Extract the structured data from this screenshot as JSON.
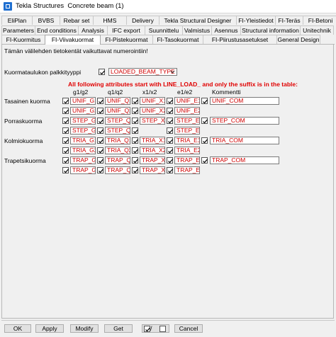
{
  "window": {
    "title": "Tekla Structures  Concrete beam (1)"
  },
  "tabs_row1": [
    "EliPlan",
    "BVBS",
    "Rebar set",
    "HMS",
    "Delivery",
    "Tekla Structural Designer",
    "FI-Yleistiedot",
    "FI-Teräs",
    "FI-Betoni"
  ],
  "tabs_row2": [
    "Parameters",
    "End conditions",
    "Analysis",
    "IFC export",
    "Suunnittelu",
    "Valmistus",
    "Asennus",
    "Structural information",
    "Unitechnik"
  ],
  "tabs_row3": [
    "FI-Kuormitus",
    "FI-Viivakuormat",
    "FI-Pistekuormat",
    "FI-Tasokuormat",
    "FI-Piirustusasetukset",
    "General Design"
  ],
  "active_tab": "FI-Viivakuormat",
  "note": "Tämän välilehden tietokentät vaikuttavat numerointiin!",
  "table_type": {
    "label": "Kuormataulukon palkkityyppi",
    "value": "LOADED_BEAM_TYPE"
  },
  "instruction": "All following attributes start with LINE_LOAD_ and only the suffix is in the table:",
  "columns": [
    "g1/g2",
    "q1/q2",
    "x1/x2",
    "e1/e2",
    "Kommentti"
  ],
  "groups": [
    {
      "label": "Tasainen kuorma",
      "row1": [
        "UNIF_G1",
        "UNIF_Q1",
        "UNIF_X1",
        "UNIF_E1"
      ],
      "row2": [
        "UNIF_G2",
        "UNIF_Q2",
        "UNIF_X2",
        "UNIF_E2"
      ],
      "comment": "UNIF_COM"
    },
    {
      "label": "Porraskuorma",
      "row1": [
        "STEP_G1",
        "STEP_Q1",
        "STEP_X1",
        "STEP_E1"
      ],
      "row2": [
        "STEP_G2",
        "STEP_Q2",
        "",
        "STEP_E2"
      ],
      "comment": "STEP_COM"
    },
    {
      "label": "Kolmiokuorma",
      "row1": [
        "TRIA_G1",
        "TRIA_Q1",
        "TRIA_X1",
        "TRIA_E1"
      ],
      "row2": [
        "TRIA_G2",
        "TRIA_Q2",
        "TRIA_X2",
        "TRIA_E2"
      ],
      "comment": "TRIA_COM"
    },
    {
      "label": "Trapetsikuorma",
      "row1": [
        "TRAP_G1",
        "TRAP_Q1",
        "TRAP_X1",
        "TRAP_E1"
      ],
      "row2": [
        "TRAP_G2",
        "TRAP_Q2",
        "TRAP_X2",
        "TRAP_E2"
      ],
      "comment": "TRAP_COM"
    }
  ],
  "buttons": {
    "ok": "OK",
    "apply": "Apply",
    "modify": "Modify",
    "get": "Get",
    "cancel": "Cancel"
  },
  "colors": {
    "field_text": "#d00000",
    "instruction_text": "#e00000"
  }
}
